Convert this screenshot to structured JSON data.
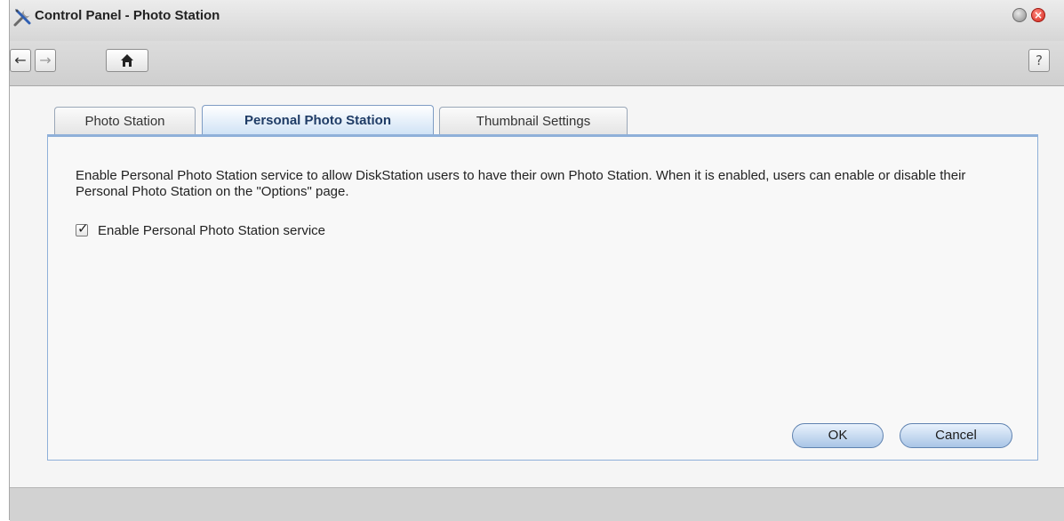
{
  "window": {
    "title": "Control Panel - Photo Station"
  },
  "toolbar": {
    "back_icon": "←",
    "forward_icon": "→",
    "home_icon": "home-icon",
    "help_label": "?"
  },
  "tabs": [
    {
      "label": "Photo Station",
      "active": false
    },
    {
      "label": "Personal Photo Station",
      "active": true
    },
    {
      "label": "Thumbnail Settings",
      "active": false
    }
  ],
  "panel": {
    "description": "Enable Personal Photo Station service to allow DiskStation users to have their own Photo Station. When it is enabled, users can enable or disable their Personal Photo Station on the \"Options\" page.",
    "checkbox": {
      "label": "Enable Personal Photo Station service",
      "checked": true
    },
    "ok_label": "OK",
    "cancel_label": "Cancel"
  },
  "colors": {
    "active_tab_text": "#1f3c66",
    "panel_border": "#8fb0d9",
    "button_border": "#5f82b0"
  }
}
